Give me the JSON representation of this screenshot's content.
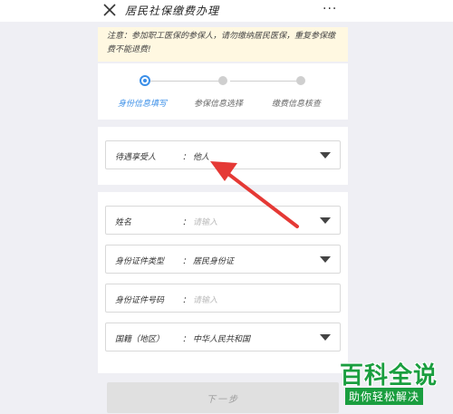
{
  "header": {
    "title": "居民社保缴费办理",
    "close_icon": "close-icon",
    "more_label": "···"
  },
  "notice": {
    "text": "注意：参加职工医保的参保人，请勿缴纳居民医保，重复参保缴费不能退费!"
  },
  "steps": [
    {
      "label": "身份信息填写",
      "active": true
    },
    {
      "label": "参保信息选择",
      "active": false
    },
    {
      "label": "缴费信息核查",
      "active": false
    }
  ],
  "form": {
    "beneficiary": {
      "label": "待遇享受人",
      "value": "他人"
    },
    "name": {
      "label": "姓名",
      "placeholder": "请输入"
    },
    "id_type": {
      "label": "身份证件类型",
      "value": "居民身份证"
    },
    "id_number": {
      "label": "身份证件号码",
      "placeholder": "请输入"
    },
    "nationality": {
      "label": "国籍（地区）",
      "value": "中华人民共和国"
    }
  },
  "next_button": {
    "label": "下一步"
  },
  "colors": {
    "accent": "#3b8fe8",
    "arrow": "#e53935",
    "notice_bg": "#fff8e1",
    "watermark": "#1a9e3f"
  },
  "watermark": {
    "title": "百科全说",
    "subtitle": "助你轻松解决"
  }
}
